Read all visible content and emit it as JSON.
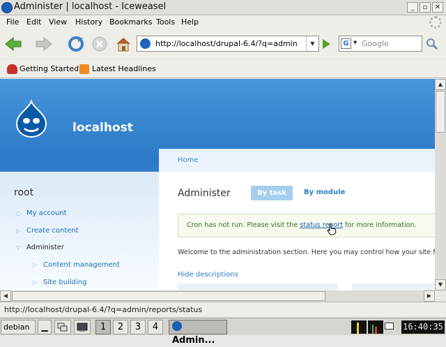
{
  "window": {
    "title": "Administer | localhost - Iceweasel"
  },
  "menu": {
    "file": "File",
    "edit": "Edit",
    "view": "View",
    "history": "History",
    "bookmarks": "Bookmarks",
    "tools": "Tools",
    "help": "Help"
  },
  "nav": {
    "url": "http://localhost/drupal-6.4/?q=admin",
    "search_placeholder": "Google"
  },
  "bookmarks": {
    "getting_started": "Getting Started",
    "latest_headlines": "Latest Headlines"
  },
  "site": {
    "name": "localhost"
  },
  "sidebar": {
    "user": "root",
    "items": [
      {
        "label": "My account"
      },
      {
        "label": "Create content"
      },
      {
        "label": "Administer"
      },
      {
        "label": "Content management"
      },
      {
        "label": "Site building"
      }
    ]
  },
  "main": {
    "breadcrumb": "Home",
    "title": "Administer",
    "tabs": [
      "By task",
      "By module"
    ],
    "message_pre": "Cron has not run. Please visit the ",
    "message_link": "status report",
    "message_post": " for more information.",
    "welcome": "Welcome to the administration section. Here you may control how your site f",
    "hide_descriptions": "Hide descriptions"
  },
  "status": {
    "text": "http://localhost/drupal-6.4/?q=admin/reports/status"
  },
  "taskbar": {
    "start": "debian",
    "workspaces": [
      "1",
      "2",
      "3",
      "4"
    ],
    "active_workspace": "1",
    "window_button": "Admin...",
    "clock": "16:40:35"
  },
  "colors": {
    "header_blue": "#2a78c7",
    "link": "#1b6fb8",
    "tab_active": "#a5cdee"
  }
}
